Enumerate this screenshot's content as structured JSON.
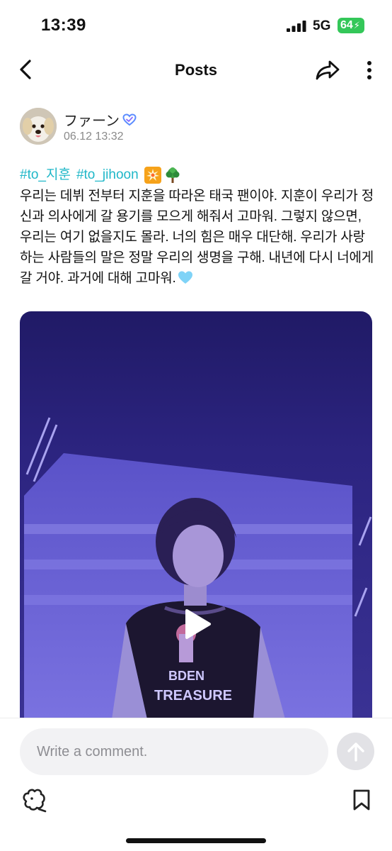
{
  "status_bar": {
    "time": "13:39",
    "network": "5G",
    "battery": "64"
  },
  "nav": {
    "title": "Posts",
    "back_icon": "chevron-left-icon",
    "share_icon": "share-arrow-icon",
    "more_icon": "vertical-ellipsis-icon"
  },
  "post": {
    "author_name": "ファーン",
    "timestamp": "06.12 13:32",
    "hashtags": [
      "#to_지훈",
      "#to_jihoon"
    ],
    "emojis": [
      "collision-burst-icon",
      "tree-icon",
      "light-blue-heart-icon"
    ],
    "body": "우리는 데뷔 전부터 지훈을 따라온 태국 팬이야. 지훈이 우리가 정신과 의사에게 갈 용기를 모으게 해줘서 고마워. 그렇지 않으면, 우리는 여기 없을지도 몰라. 너의 힘은 매우 대단해. 우리가 사랑하는 사람들의 말은 정말 우리의 생명을 구해. 내년에 다시 너에게 갈 거야. 과거에 대해 고마워."
  },
  "media": {
    "shirt_text_1": "BDEN",
    "shirt_text_2": "TREASURE"
  },
  "comment": {
    "placeholder": "Write a comment."
  },
  "colors": {
    "hashtag": "#1fb7c8",
    "verified": "#5b8cff",
    "battery": "#34c759",
    "media_purple": "#3b2f8a"
  }
}
